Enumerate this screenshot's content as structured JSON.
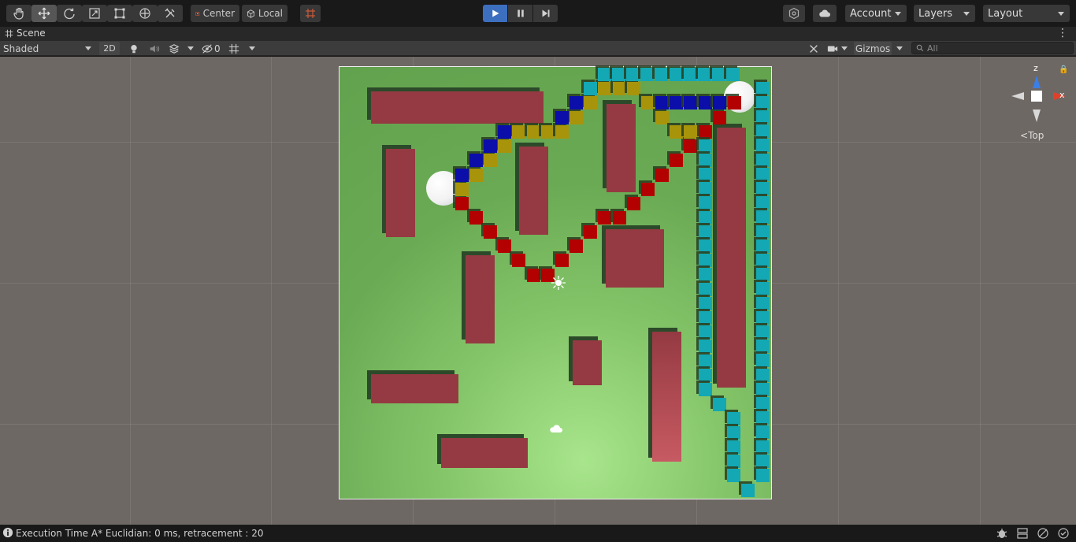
{
  "toolbar": {
    "tools": [
      "hand-tool",
      "move-tool",
      "rotate-tool",
      "scale-tool",
      "rect-tool",
      "transform-tool",
      "custom-tool"
    ],
    "pivot_label": "Center",
    "space_label": "Local",
    "account_label": "Account",
    "layers_label": "Layers",
    "layout_label": "Layout"
  },
  "scene_tab": {
    "label": "Scene"
  },
  "scene_toolbar": {
    "shading_mode": "Shaded",
    "mode_2d": "2D",
    "hidden_count": "0",
    "gizmos_label": "Gizmos",
    "search_placeholder": "All"
  },
  "gizmo": {
    "z_label": "z",
    "x_label": "x",
    "view_label": "Top"
  },
  "status": {
    "message": "Execution Time A* Euclidian: 0 ms, retracement : 20"
  },
  "colors": {
    "ground": "#6aaa54",
    "walls": "#953a42",
    "path_red": "#b30000",
    "path_yellow": "#a8940a",
    "path_blue": "#0b0ea8",
    "path_cyan": "#13a8b4",
    "play_active": "#3d6fbf"
  }
}
